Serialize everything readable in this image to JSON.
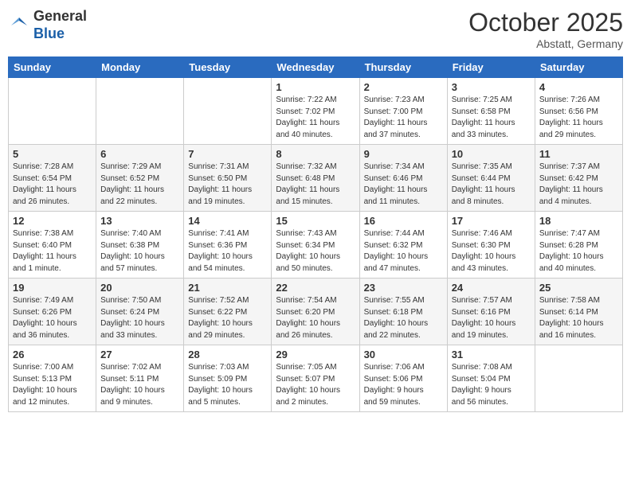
{
  "header": {
    "logo_general": "General",
    "logo_blue": "Blue",
    "month": "October 2025",
    "location": "Abstatt, Germany"
  },
  "weekdays": [
    "Sunday",
    "Monday",
    "Tuesday",
    "Wednesday",
    "Thursday",
    "Friday",
    "Saturday"
  ],
  "weeks": [
    [
      {
        "day": "",
        "info": ""
      },
      {
        "day": "",
        "info": ""
      },
      {
        "day": "",
        "info": ""
      },
      {
        "day": "1",
        "info": "Sunrise: 7:22 AM\nSunset: 7:02 PM\nDaylight: 11 hours\nand 40 minutes."
      },
      {
        "day": "2",
        "info": "Sunrise: 7:23 AM\nSunset: 7:00 PM\nDaylight: 11 hours\nand 37 minutes."
      },
      {
        "day": "3",
        "info": "Sunrise: 7:25 AM\nSunset: 6:58 PM\nDaylight: 11 hours\nand 33 minutes."
      },
      {
        "day": "4",
        "info": "Sunrise: 7:26 AM\nSunset: 6:56 PM\nDaylight: 11 hours\nand 29 minutes."
      }
    ],
    [
      {
        "day": "5",
        "info": "Sunrise: 7:28 AM\nSunset: 6:54 PM\nDaylight: 11 hours\nand 26 minutes."
      },
      {
        "day": "6",
        "info": "Sunrise: 7:29 AM\nSunset: 6:52 PM\nDaylight: 11 hours\nand 22 minutes."
      },
      {
        "day": "7",
        "info": "Sunrise: 7:31 AM\nSunset: 6:50 PM\nDaylight: 11 hours\nand 19 minutes."
      },
      {
        "day": "8",
        "info": "Sunrise: 7:32 AM\nSunset: 6:48 PM\nDaylight: 11 hours\nand 15 minutes."
      },
      {
        "day": "9",
        "info": "Sunrise: 7:34 AM\nSunset: 6:46 PM\nDaylight: 11 hours\nand 11 minutes."
      },
      {
        "day": "10",
        "info": "Sunrise: 7:35 AM\nSunset: 6:44 PM\nDaylight: 11 hours\nand 8 minutes."
      },
      {
        "day": "11",
        "info": "Sunrise: 7:37 AM\nSunset: 6:42 PM\nDaylight: 11 hours\nand 4 minutes."
      }
    ],
    [
      {
        "day": "12",
        "info": "Sunrise: 7:38 AM\nSunset: 6:40 PM\nDaylight: 11 hours\nand 1 minute."
      },
      {
        "day": "13",
        "info": "Sunrise: 7:40 AM\nSunset: 6:38 PM\nDaylight: 10 hours\nand 57 minutes."
      },
      {
        "day": "14",
        "info": "Sunrise: 7:41 AM\nSunset: 6:36 PM\nDaylight: 10 hours\nand 54 minutes."
      },
      {
        "day": "15",
        "info": "Sunrise: 7:43 AM\nSunset: 6:34 PM\nDaylight: 10 hours\nand 50 minutes."
      },
      {
        "day": "16",
        "info": "Sunrise: 7:44 AM\nSunset: 6:32 PM\nDaylight: 10 hours\nand 47 minutes."
      },
      {
        "day": "17",
        "info": "Sunrise: 7:46 AM\nSunset: 6:30 PM\nDaylight: 10 hours\nand 43 minutes."
      },
      {
        "day": "18",
        "info": "Sunrise: 7:47 AM\nSunset: 6:28 PM\nDaylight: 10 hours\nand 40 minutes."
      }
    ],
    [
      {
        "day": "19",
        "info": "Sunrise: 7:49 AM\nSunset: 6:26 PM\nDaylight: 10 hours\nand 36 minutes."
      },
      {
        "day": "20",
        "info": "Sunrise: 7:50 AM\nSunset: 6:24 PM\nDaylight: 10 hours\nand 33 minutes."
      },
      {
        "day": "21",
        "info": "Sunrise: 7:52 AM\nSunset: 6:22 PM\nDaylight: 10 hours\nand 29 minutes."
      },
      {
        "day": "22",
        "info": "Sunrise: 7:54 AM\nSunset: 6:20 PM\nDaylight: 10 hours\nand 26 minutes."
      },
      {
        "day": "23",
        "info": "Sunrise: 7:55 AM\nSunset: 6:18 PM\nDaylight: 10 hours\nand 22 minutes."
      },
      {
        "day": "24",
        "info": "Sunrise: 7:57 AM\nSunset: 6:16 PM\nDaylight: 10 hours\nand 19 minutes."
      },
      {
        "day": "25",
        "info": "Sunrise: 7:58 AM\nSunset: 6:14 PM\nDaylight: 10 hours\nand 16 minutes."
      }
    ],
    [
      {
        "day": "26",
        "info": "Sunrise: 7:00 AM\nSunset: 5:13 PM\nDaylight: 10 hours\nand 12 minutes."
      },
      {
        "day": "27",
        "info": "Sunrise: 7:02 AM\nSunset: 5:11 PM\nDaylight: 10 hours\nand 9 minutes."
      },
      {
        "day": "28",
        "info": "Sunrise: 7:03 AM\nSunset: 5:09 PM\nDaylight: 10 hours\nand 5 minutes."
      },
      {
        "day": "29",
        "info": "Sunrise: 7:05 AM\nSunset: 5:07 PM\nDaylight: 10 hours\nand 2 minutes."
      },
      {
        "day": "30",
        "info": "Sunrise: 7:06 AM\nSunset: 5:06 PM\nDaylight: 9 hours\nand 59 minutes."
      },
      {
        "day": "31",
        "info": "Sunrise: 7:08 AM\nSunset: 5:04 PM\nDaylight: 9 hours\nand 56 minutes."
      },
      {
        "day": "",
        "info": ""
      }
    ]
  ]
}
